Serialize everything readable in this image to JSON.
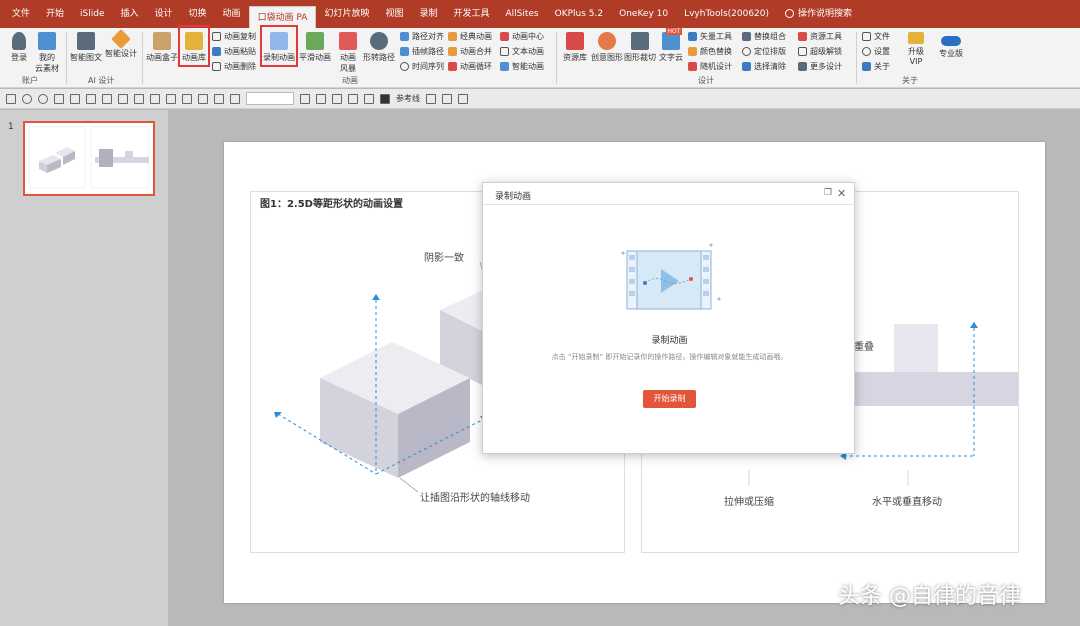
{
  "tabs": [
    "文件",
    "开始",
    "iSlide",
    "插入",
    "设计",
    "切换",
    "动画",
    "口袋动画 PA",
    "幻灯片放映",
    "视图",
    "录制",
    "开发工具",
    "AllSites",
    "OKPlus 5.2",
    "OneKey 10",
    "LvyhTools(200620)",
    "操作说明搜索"
  ],
  "ribbon": {
    "login": "登录",
    "my_material_1": "我的",
    "my_material_2": "云素材",
    "group_account": "账户",
    "smart_graphic": "智能图文",
    "smart_design": "智能设计",
    "group_ai": "AI 设计",
    "anim_box": "动画盒子",
    "anim_lib": "动画库",
    "anim_copy": "动画复制",
    "anim_paste": "动画粘贴",
    "anim_delete": "动画删除",
    "record_anim": "录制动画",
    "smooth_anim": "平滑动画",
    "anim_wind_1": "动画",
    "anim_wind_2": "风暴",
    "shape_path": "形转路径",
    "path_align": "路径对齐",
    "path_copy": "插帧路径",
    "timeline": "时间序列",
    "classic_anim": "经典动画",
    "anim_merge": "动画合并",
    "anim_loop": "动画循环",
    "anim_center": "动画中心",
    "text_anim": "文本动画",
    "smart_anim": "智能动画",
    "group_anim": "动画",
    "resource_lib": "资源库",
    "creative_shape": "创意图形",
    "shape_slice": "图形裁切",
    "text_cloud": "文字云",
    "vector_tools": "矢量工具",
    "color_replace": "颜色替换",
    "random_design": "随机设计",
    "replace_combo": "替换组合",
    "position_layout": "定位排版",
    "select_clear": "选择清除",
    "resource_tools": "资源工具",
    "super_unlock": "超级解锁",
    "more_design": "更多设计",
    "group_design": "设计",
    "file": "文件",
    "settings": "设置",
    "about": "关于",
    "upgrade_1": "升级",
    "upgrade_2": "VIP",
    "pro_version": "专业版",
    "group_about": "关于",
    "hot_badge": "HOT"
  },
  "qat": {
    "ref_line": "参考线"
  },
  "thumb_pane": {
    "slide_number": "1"
  },
  "slide": {
    "fig_title": "图1：2.5D等距形状的动画设置",
    "label_shadow": "阴影一致",
    "label_move_axis": "让插图沿形状的轴线移动",
    "label_overlap": "重叠",
    "label_stretch": "拉伸或压缩",
    "label_move_hv": "水平或垂直移动"
  },
  "dialog": {
    "title": "录制动画",
    "heading": "录制动画",
    "description": "点击 “开始录制” 即开始记录你的操作路径，操作编辑对象就能生成动画哦。",
    "start_button": "开始录制"
  },
  "watermark": "头条 @自律的音律",
  "colors": {
    "tab_bar": "#b03b27",
    "accent": "#e2553a",
    "highlight_box": "#e0393a",
    "shape_face_light": "#e8e8ee",
    "shape_face_mid": "#d3d3dd",
    "shape_face_dark": "#b8b8c6",
    "guide_blue": "#2a8fd8"
  }
}
